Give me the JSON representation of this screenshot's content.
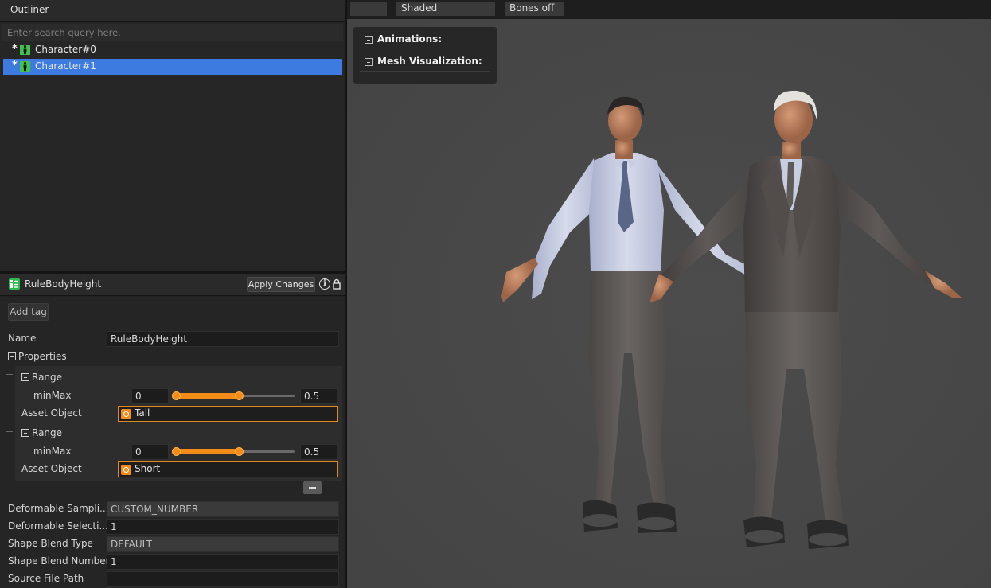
{
  "outliner": {
    "title": "Outliner",
    "search_placeholder": "Enter search query here.",
    "items": [
      {
        "star": "*",
        "label": "Character#0",
        "selected": false
      },
      {
        "star": "*",
        "label": "Character#1",
        "selected": true
      }
    ]
  },
  "inspector": {
    "title": "RuleBodyHeight",
    "apply_label": "Apply Changes",
    "add_tag_label": "Add tag",
    "name_label": "Name",
    "name_value": "RuleBodyHeight",
    "properties_label": "Properties",
    "ranges": [
      {
        "label": "Range",
        "minmax_label": "minMax",
        "min": "0",
        "max": "0.5",
        "slider_from": 0.0,
        "slider_to": 0.5,
        "asset_label": "Asset Object",
        "asset_value": "Tall"
      },
      {
        "label": "Range",
        "minmax_label": "minMax",
        "min": "0",
        "max": "0.5",
        "slider_from": 0.0,
        "slider_to": 0.5,
        "asset_label": "Asset Object",
        "asset_value": "Short"
      }
    ],
    "rows": [
      {
        "label": "Deformable Sampli...",
        "value": "CUSTOM_NUMBER",
        "disabled": true
      },
      {
        "label": "Deformable Selecti...",
        "value": "1",
        "disabled": false
      },
      {
        "label": "Shape Blend Type",
        "value": "DEFAULT",
        "disabled": true
      },
      {
        "label": "Shape Blend Number",
        "value": "1",
        "disabled": false
      },
      {
        "label": "Source File Path",
        "value": "",
        "disabled": false
      }
    ]
  },
  "viewport": {
    "toolbar": {
      "blank": "",
      "shading": "Shaded",
      "bones": "Bones off"
    },
    "panel": {
      "animations": "Animations:",
      "mesh_vis": "Mesh Visualization:"
    }
  },
  "colors": {
    "accent": "#f28c17",
    "selection": "#3d7be0",
    "icon_green": "#3fc34d"
  }
}
